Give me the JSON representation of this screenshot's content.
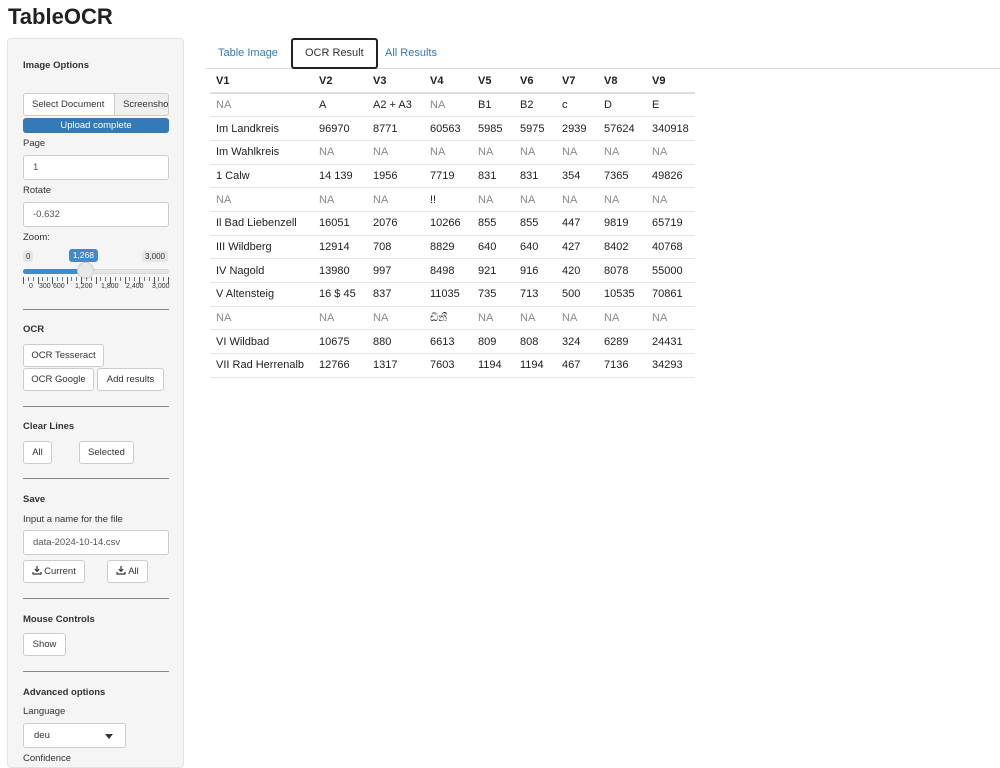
{
  "app": {
    "title": "TableOCR"
  },
  "sidebar": {
    "image_options": {
      "heading": "Image Options",
      "source_tabs": [
        "Select Document",
        "Screenshot"
      ],
      "upload_status": "Upload complete",
      "upload_progress": 1.0,
      "page_label": "Page",
      "page_value": "1",
      "rotate_label": "Rotate",
      "rotate_value": "-0.632",
      "zoom_label": "Zoom:",
      "zoom_min": "0",
      "zoom_max": "3,000",
      "zoom_value": "1,268",
      "zoom_fraction": 0.4227,
      "zoom_ticks": [
        "0",
        "300",
        "600",
        "1,200",
        "1,800",
        "2,400",
        "3,000"
      ]
    },
    "ocr": {
      "heading": "OCR",
      "tesseract": "OCR Tesseract",
      "google": "OCR Google",
      "add_results": "Add results"
    },
    "clear_lines": {
      "heading": "Clear Lines",
      "all": "All",
      "selected": "Selected"
    },
    "save": {
      "heading": "Save",
      "filename_label": "Input a name for the file",
      "filename_value": "data-2024-10-14.csv",
      "current": "Current",
      "all": "All"
    },
    "mouse_controls": {
      "heading": "Mouse Controls",
      "show": "Show"
    },
    "advanced": {
      "heading": "Advanced options",
      "language_label": "Language",
      "language_value": "deu",
      "confidence_label": "Confidence"
    }
  },
  "main": {
    "tabs": [
      {
        "label": "Table Image",
        "active": false
      },
      {
        "label": "OCR Result",
        "active": true
      },
      {
        "label": "All Results",
        "active": false
      }
    ],
    "table": {
      "columns": [
        "V1",
        "V2",
        "V3",
        "V4",
        "V5",
        "V6",
        "V7",
        "V8",
        "V9"
      ],
      "rows": [
        [
          "NA",
          "A",
          "A2 + A3",
          "NA",
          "B1",
          "B2",
          "c",
          "D",
          "E"
        ],
        [
          "Im Landkreis",
          "96970",
          "8771",
          "60563",
          "5985",
          "5975",
          "2939",
          "57624",
          "340918"
        ],
        [
          "Im Wahlkreis",
          "NA",
          "NA",
          "NA",
          "NA",
          "NA",
          "NA",
          "NA",
          "NA"
        ],
        [
          "1 Calw",
          "14 139",
          "1956",
          "7719",
          "831",
          "831",
          "354",
          "7365",
          "49826"
        ],
        [
          "NA",
          "NA",
          "NA",
          "!!",
          "NA",
          "NA",
          "NA",
          "NA",
          "NA"
        ],
        [
          "Il Bad Liebenzell",
          "16051",
          "2076",
          "10266",
          "855",
          "855",
          "447",
          "9819",
          "65719"
        ],
        [
          "III Wildberg",
          "12914",
          "708",
          "8829",
          "640",
          "640",
          "427",
          "8402",
          "40768"
        ],
        [
          "IV Nagold",
          "13980",
          "997",
          "8498",
          "921",
          "916",
          "420",
          "8078",
          "55000"
        ],
        [
          "V Altensteig",
          "16 $ 45",
          "837",
          "11035",
          "735",
          "713",
          "500",
          "10535",
          "70861"
        ],
        [
          "NA",
          "NA",
          "NA",
          "ඩිනී",
          "NA",
          "NA",
          "NA",
          "NA",
          "NA"
        ],
        [
          "VI Wildbad",
          "10675",
          "880",
          "6613",
          "809",
          "808",
          "324",
          "6289",
          "24431"
        ],
        [
          "VII Rad Herrenalb",
          "12766",
          "1317",
          "7603",
          "1194",
          "1194",
          "467",
          "7136",
          "34293"
        ]
      ]
    }
  },
  "colors": {
    "accent": "#337ab7",
    "slider": "#428bca",
    "na_text": "#8a8a8a"
  },
  "icons": {
    "download": "download-icon",
    "caret": "chevron-down-icon"
  }
}
